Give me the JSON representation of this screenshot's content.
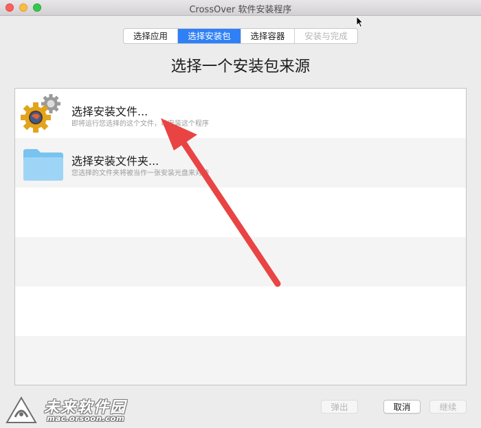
{
  "window": {
    "title": "CrossOver 软件安装程序"
  },
  "tabs": [
    {
      "label": "选择应用",
      "state": "normal"
    },
    {
      "label": "选择安装包",
      "state": "active"
    },
    {
      "label": "选择容器",
      "state": "normal"
    },
    {
      "label": "安装与完成",
      "state": "disabled"
    }
  ],
  "heading": "选择一个安装包来源",
  "sources": [
    {
      "icon": "installer-gear-icon",
      "title": "选择安装文件...",
      "description": "即将运行您选择的这个文件，以安装这个程序"
    },
    {
      "icon": "folder-icon",
      "title": "选择安装文件夹...",
      "description": "您选择的文件夹将被当作一张安装光盘来对待"
    }
  ],
  "buttons": {
    "eject": "弹出",
    "cancel": "取消",
    "continue": "继续"
  },
  "watermark": {
    "name": "未来软件园",
    "url": "mac.orsoon.com"
  },
  "colors": {
    "accent": "#2f80f7",
    "annotation_arrow": "#e94444"
  }
}
